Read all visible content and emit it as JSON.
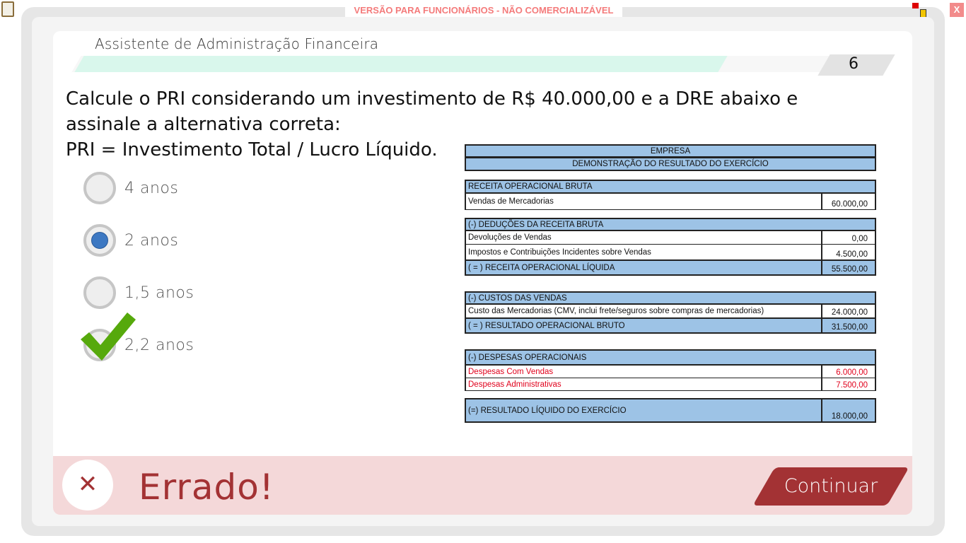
{
  "banner": "VERSÃO PARA FUNCIONÁRIOS - NÃO COMERCIALIZÁVEL",
  "close_label": "X",
  "app_title": "Assistente de Administração Financeira",
  "progress_percent": 85,
  "page_number": "6",
  "question": [
    "Calcule o PRI considerando um investimento de R$ 40.000,00 e a DRE abaixo e",
    "assinale a alternativa correta:",
    "PRI = Investimento Total / Lucro Líquido."
  ],
  "options": [
    {
      "label": "4 anos",
      "selected": false
    },
    {
      "label": "2 anos",
      "selected": true
    },
    {
      "label": "1,5 anos",
      "selected": false
    },
    {
      "label": "2,2 anos",
      "selected": false,
      "correct": true
    }
  ],
  "dre": {
    "company": "EMPRESA",
    "title": "DEMONSTRAÇÃO DO RESULTADO DO EXERCÍCIO",
    "rows": [
      {
        "label": "RECEITA OPERACIONAL BRUTA"
      },
      {
        "label": "Vendas de Mercadorias",
        "value": "60.000,00"
      },
      {
        "label": "(-) DEDUÇÕES DA RECEITA BRUTA"
      },
      {
        "label": "Devoluções de Vendas",
        "value": "0,00"
      },
      {
        "label": "Impostos e Contribuições Incidentes sobre Vendas",
        "value": "4.500,00"
      },
      {
        "label": "( = ) RECEITA OPERACIONAL LÍQUIDA",
        "value": "55.500,00"
      },
      {
        "label": "(-) CUSTOS DAS VENDAS"
      },
      {
        "label": "Custo das Mercadorias  (CMV, inclui frete/seguros sobre compras de mercadorias)",
        "value": "24.000,00"
      },
      {
        "label": "( = ) RESULTADO OPERACIONAL BRUTO",
        "value": "31.500,00"
      },
      {
        "label": "(-) DESPESAS OPERACIONAIS"
      },
      {
        "label": "Despesas Com Vendas",
        "value": "6.000,00"
      },
      {
        "label": "Despesas Administrativas",
        "value": "7.500,00"
      },
      {
        "label": "(=) RESULTADO LÍQUIDO DO EXERCÍCIO",
        "value": "18.000,00"
      }
    ]
  },
  "feedback": {
    "text": "Errado!",
    "icon": "x-icon",
    "color": "#a33234"
  },
  "continue_label": "Continuar"
}
